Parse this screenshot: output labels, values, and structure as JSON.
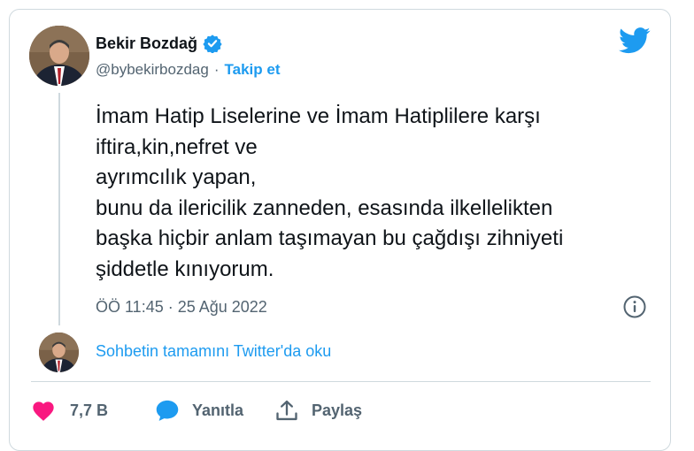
{
  "author": {
    "name": "Bekir Bozdağ",
    "handle": "@bybekirbozdag",
    "separator": "·",
    "follow_label": "Takip et"
  },
  "tweet": {
    "text": "İmam Hatip Liselerine ve İmam Hatiplilere karşı\niftira,kin,nefret ve\nayrımcılık yapan,\nbunu da ilericilik zanneden, esasında ilkellelikten\nbaşka hiçbir anlam taşımayan bu çağdışı zihniyeti\nşiddetle kınıyorum.",
    "timestamp": "ÖÖ 11:45 · 25 Ağu 2022"
  },
  "thread": {
    "read_more": "Sohbetin tamamını Twitter'da oku"
  },
  "actions": {
    "like_count": "7,7 B",
    "reply_label": "Yanıtla",
    "share_label": "Paylaş"
  },
  "colors": {
    "accent": "#1d9bf0",
    "like": "#f91880",
    "muted": "#536471",
    "border": "#cfd9de"
  },
  "icons": {
    "verified": "verified-badge-icon",
    "brand": "twitter-bird-icon",
    "info": "info-icon",
    "like": "heart-icon",
    "reply": "speech-bubble-icon",
    "share": "share-upload-icon"
  }
}
